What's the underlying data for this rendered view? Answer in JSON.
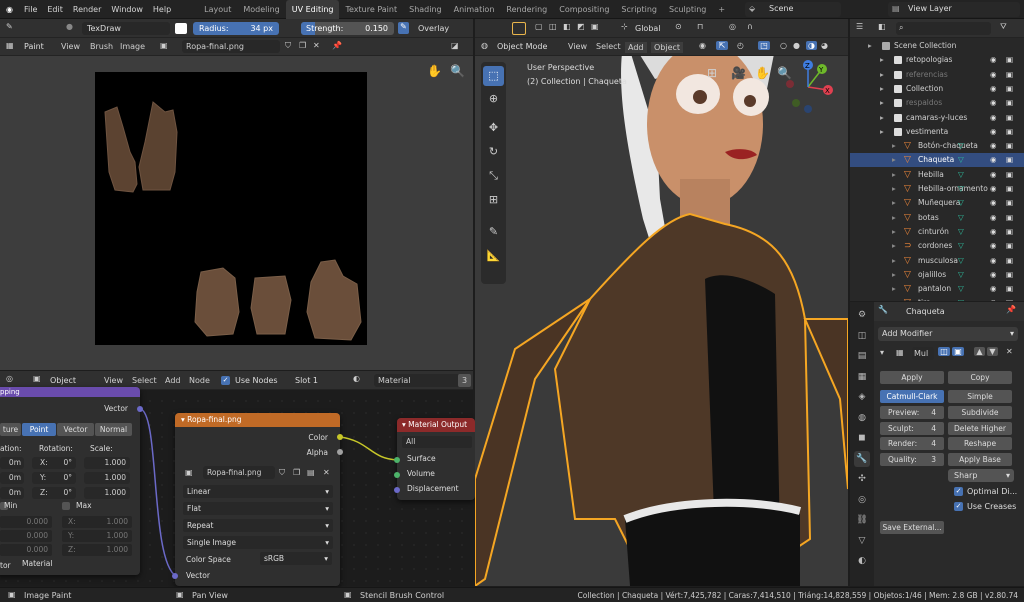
{
  "topbar": {
    "menus": [
      "File",
      "Edit",
      "Render",
      "Window",
      "Help"
    ],
    "workspaces": [
      "Layout",
      "Modeling",
      "UV Editing",
      "Texture Paint",
      "Shading",
      "Animation",
      "Rendering",
      "Compositing",
      "Scripting",
      "Sculpting"
    ],
    "active_workspace": "UV Editing",
    "scene": "Scene",
    "view_layer": "View Layer",
    "add_tab": "+"
  },
  "image_editor": {
    "brush_name": "TexDraw",
    "radius_label": "Radius:",
    "radius_value": "34 px",
    "strength_label": "Strength:",
    "strength_value": "0.150",
    "overlay": "Overlay",
    "mode": "Paint",
    "menu": [
      "View",
      "Brush",
      "Image"
    ],
    "image_name": "Ropa-final.png"
  },
  "viewport": {
    "mode": "Object Mode",
    "menu": [
      "View",
      "Select",
      "Add",
      "Object"
    ],
    "orientation": "Global",
    "info_line1": "User Perspective",
    "info_line2": "(2) Collection | Chaqueta",
    "gizmo": {
      "x": "X",
      "y": "Y",
      "z": "Z"
    }
  },
  "node_editor": {
    "editor_type": "Object",
    "menu": [
      "View",
      "Select",
      "Add",
      "Node"
    ],
    "use_nodes": "Use Nodes",
    "slot": "Slot 1",
    "material": "Material",
    "user_count": "3",
    "mapping": {
      "vector_out": "Vector",
      "tabs": [
        "ture",
        "Point",
        "Vector",
        "Normal"
      ],
      "active_tab": "Point",
      "headers": [
        "ation:",
        "Rotation:",
        "Scale:"
      ],
      "loc": [
        "0m",
        "0m",
        "0m"
      ],
      "rot_axes": [
        "X:",
        "Y:",
        "Z:"
      ],
      "rot": [
        "0°",
        "0°",
        "0°"
      ],
      "scale": [
        "1.000",
        "1.000",
        "1.000"
      ],
      "min": "Min",
      "max": "Max",
      "min_vals": [
        "0.000",
        "0.000",
        "0.000"
      ],
      "max_axes": [
        "X:",
        "Y:",
        "Z:"
      ],
      "max_vals": [
        "1.000",
        "1.000",
        "1.000"
      ],
      "bottom_left": "tor",
      "bottom_label": "Material",
      "title_fragment": "pping"
    },
    "image_tex": {
      "title": "Ropa-final.png",
      "out_color": "Color",
      "out_alpha": "Alpha",
      "image": "Ropa-final.png",
      "interpolation": "Linear",
      "projection": "Flat",
      "extension": "Repeat",
      "source": "Single Image",
      "color_space_label": "Color Space",
      "color_space": "sRGB",
      "in_vector": "Vector"
    },
    "output": {
      "title": "Material Output",
      "target": "All",
      "inputs": [
        "Surface",
        "Volume",
        "Displacement"
      ]
    }
  },
  "outliner": {
    "items": [
      {
        "label": "Scene Collection",
        "indent": 0,
        "type": "collection"
      },
      {
        "label": "retopologias",
        "indent": 1,
        "type": "collection"
      },
      {
        "label": "referencias",
        "indent": 1,
        "type": "collection",
        "dim": true
      },
      {
        "label": "Collection",
        "indent": 1,
        "type": "collection"
      },
      {
        "label": "respaldos",
        "indent": 1,
        "type": "collection",
        "dim": true
      },
      {
        "label": "camaras-y-luces",
        "indent": 1,
        "type": "collection"
      },
      {
        "label": "vestimenta",
        "indent": 1,
        "type": "collection"
      },
      {
        "label": "Botón-chaqueta",
        "indent": 2,
        "type": "mesh"
      },
      {
        "label": "Chaqueta",
        "indent": 2,
        "type": "mesh",
        "selected": true
      },
      {
        "label": "Hebilla",
        "indent": 2,
        "type": "mesh"
      },
      {
        "label": "Hebilla-ornamento",
        "indent": 2,
        "type": "mesh"
      },
      {
        "label": "Muñequera",
        "indent": 2,
        "type": "mesh"
      },
      {
        "label": "botas",
        "indent": 2,
        "type": "mesh"
      },
      {
        "label": "cinturón",
        "indent": 2,
        "type": "mesh"
      },
      {
        "label": "cordones",
        "indent": 2,
        "type": "curve"
      },
      {
        "label": "musculosa",
        "indent": 2,
        "type": "mesh"
      },
      {
        "label": "ojalillos",
        "indent": 2,
        "type": "mesh"
      },
      {
        "label": "pantalon",
        "indent": 2,
        "type": "mesh"
      },
      {
        "label": "tira",
        "indent": 2,
        "type": "mesh"
      }
    ]
  },
  "properties": {
    "object_name": "Chaqueta",
    "add_modifier": "Add Modifier",
    "modifier_name": "Mul",
    "apply": "Apply",
    "copy": "Copy",
    "algorithms": [
      "Catmull-Clark",
      "Simple"
    ],
    "active_algorithm": "Catmull-Clark",
    "fields": [
      {
        "label": "Preview:",
        "value": "4",
        "action": "Subdivide"
      },
      {
        "label": "Sculpt:",
        "value": "4",
        "action": "Delete Higher"
      },
      {
        "label": "Render:",
        "value": "4",
        "action": "Reshape"
      },
      {
        "label": "Quality:",
        "value": "3",
        "action": "Apply Base"
      }
    ],
    "sharp": "Sharp",
    "optimal": "Optimal Di...",
    "creases": "Use Creases",
    "save_external": "Save External..."
  },
  "statusbar": {
    "left": "Image Paint",
    "middle": "Pan View",
    "right": "Stencil Brush Control",
    "info": "Collection | Chaqueta | Vért:7,425,782 | Caras:7,414,510 | Triáng:14,828,559 | Objetos:1/46 | Mem: 2.8 GB | v2.80.74"
  },
  "colors": {
    "accent": "#4772b3",
    "selection_orange": "#f5a623",
    "output_header": "#8c2a2a",
    "image_header": "#c06a26",
    "mapping_header": "#6a4cad"
  }
}
